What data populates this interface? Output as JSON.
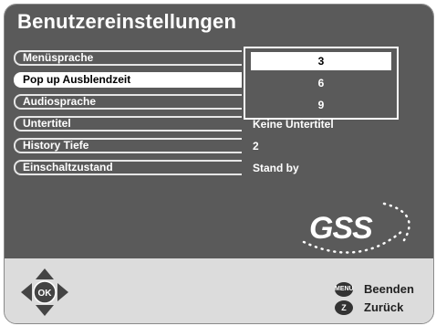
{
  "title": "Benutzereinstellungen",
  "menu": [
    {
      "label": "Menüsprache",
      "value": ""
    },
    {
      "label": "Pop up Ausblendzeit",
      "value": ""
    },
    {
      "label": "Audiosprache",
      "value": ""
    },
    {
      "label": "Untertitel",
      "value": "Keine Untertitel"
    },
    {
      "label": "History Tiefe",
      "value": "2"
    },
    {
      "label": "Einschaltzustand",
      "value": "Stand by"
    }
  ],
  "dropdown": {
    "options": [
      "3",
      "6",
      "9"
    ],
    "selected": "3"
  },
  "logo": "GSS",
  "dpad": {
    "center": "OK"
  },
  "hints": {
    "menu_key": "MENU",
    "menu_label": "Beenden",
    "back_key": "Z",
    "back_label": "Zurück"
  }
}
